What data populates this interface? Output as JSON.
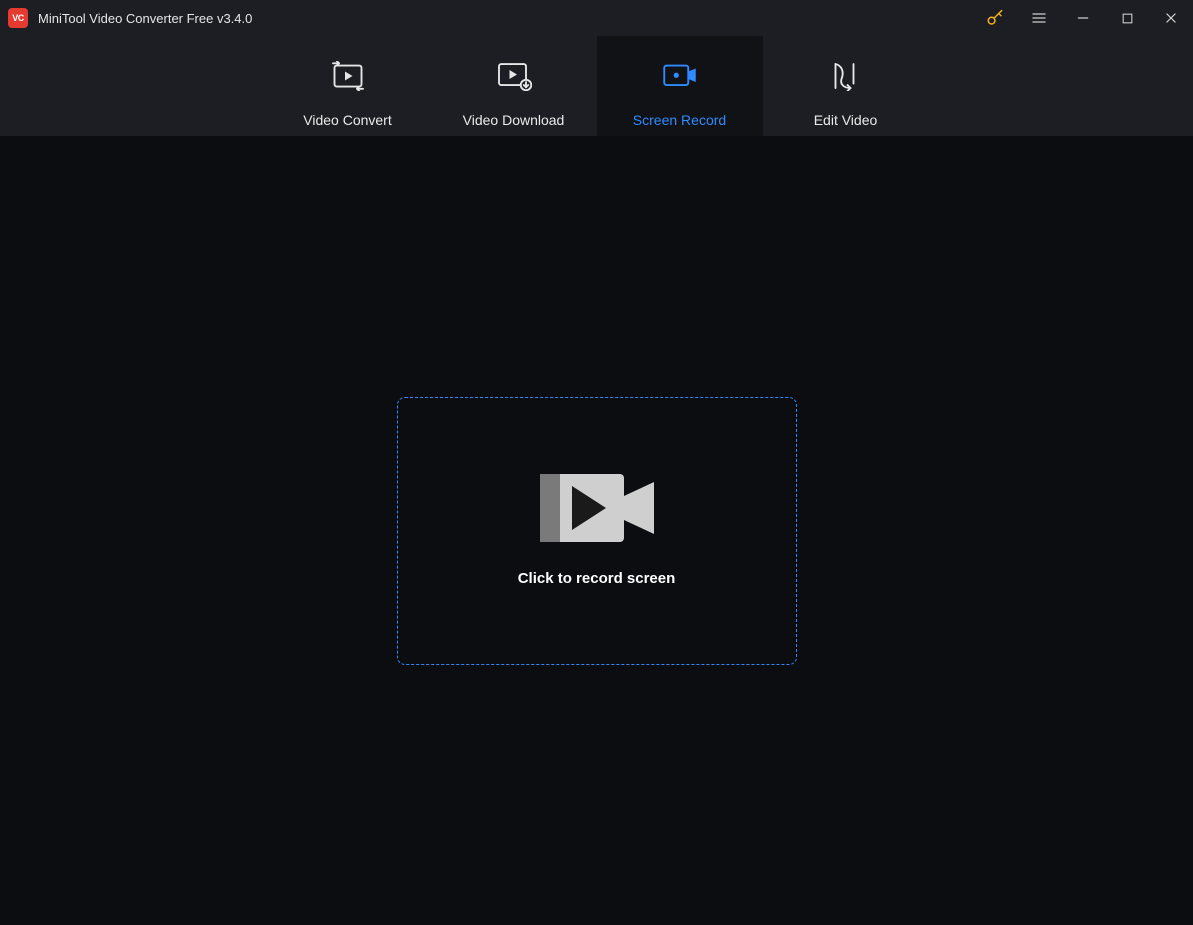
{
  "titlebar": {
    "logo_text": "VC",
    "title": "MiniTool Video Converter Free v3.4.0"
  },
  "tabs": {
    "items": [
      {
        "label": "Video Convert",
        "active": false
      },
      {
        "label": "Video Download",
        "active": false
      },
      {
        "label": "Screen Record",
        "active": true
      },
      {
        "label": "Edit Video",
        "active": false
      }
    ]
  },
  "main": {
    "record_prompt": "Click to record screen"
  }
}
